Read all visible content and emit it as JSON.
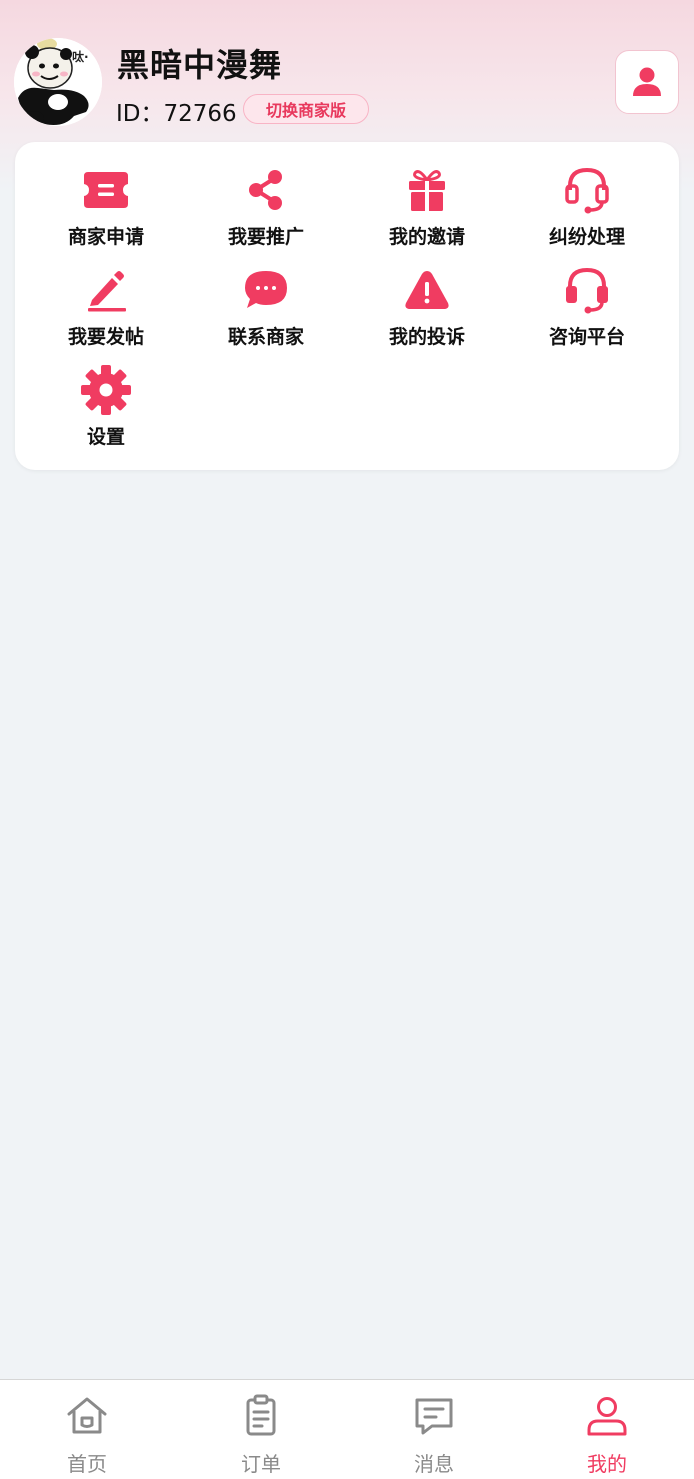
{
  "profile": {
    "name": "黑暗中漫舞",
    "id_text": "ID：72766",
    "switch_label": "切换商家版",
    "avatar_tag": "呔·"
  },
  "menu": {
    "items": [
      {
        "label": "商家申请",
        "icon": "ticket-icon"
      },
      {
        "label": "我要推广",
        "icon": "share-icon"
      },
      {
        "label": "我的邀请",
        "icon": "gift-icon"
      },
      {
        "label": "纠纷处理",
        "icon": "headset-icon"
      },
      {
        "label": "我要发帖",
        "icon": "pencil-icon"
      },
      {
        "label": "联系商家",
        "icon": "chat-bubble-icon"
      },
      {
        "label": "我的投诉",
        "icon": "warning-icon"
      },
      {
        "label": "咨询平台",
        "icon": "headset-icon"
      },
      {
        "label": "设置",
        "icon": "gear-icon"
      }
    ]
  },
  "nav": {
    "items": [
      {
        "label": "首页",
        "icon": "home-icon"
      },
      {
        "label": "订单",
        "icon": "clipboard-icon"
      },
      {
        "label": "消息",
        "icon": "message-icon"
      },
      {
        "label": "我的",
        "icon": "user-icon"
      }
    ],
    "active": "我的"
  },
  "colors": {
    "accent": "#f03c61",
    "nav_inactive": "#8a8a8a",
    "background": "#f0f3f6"
  }
}
